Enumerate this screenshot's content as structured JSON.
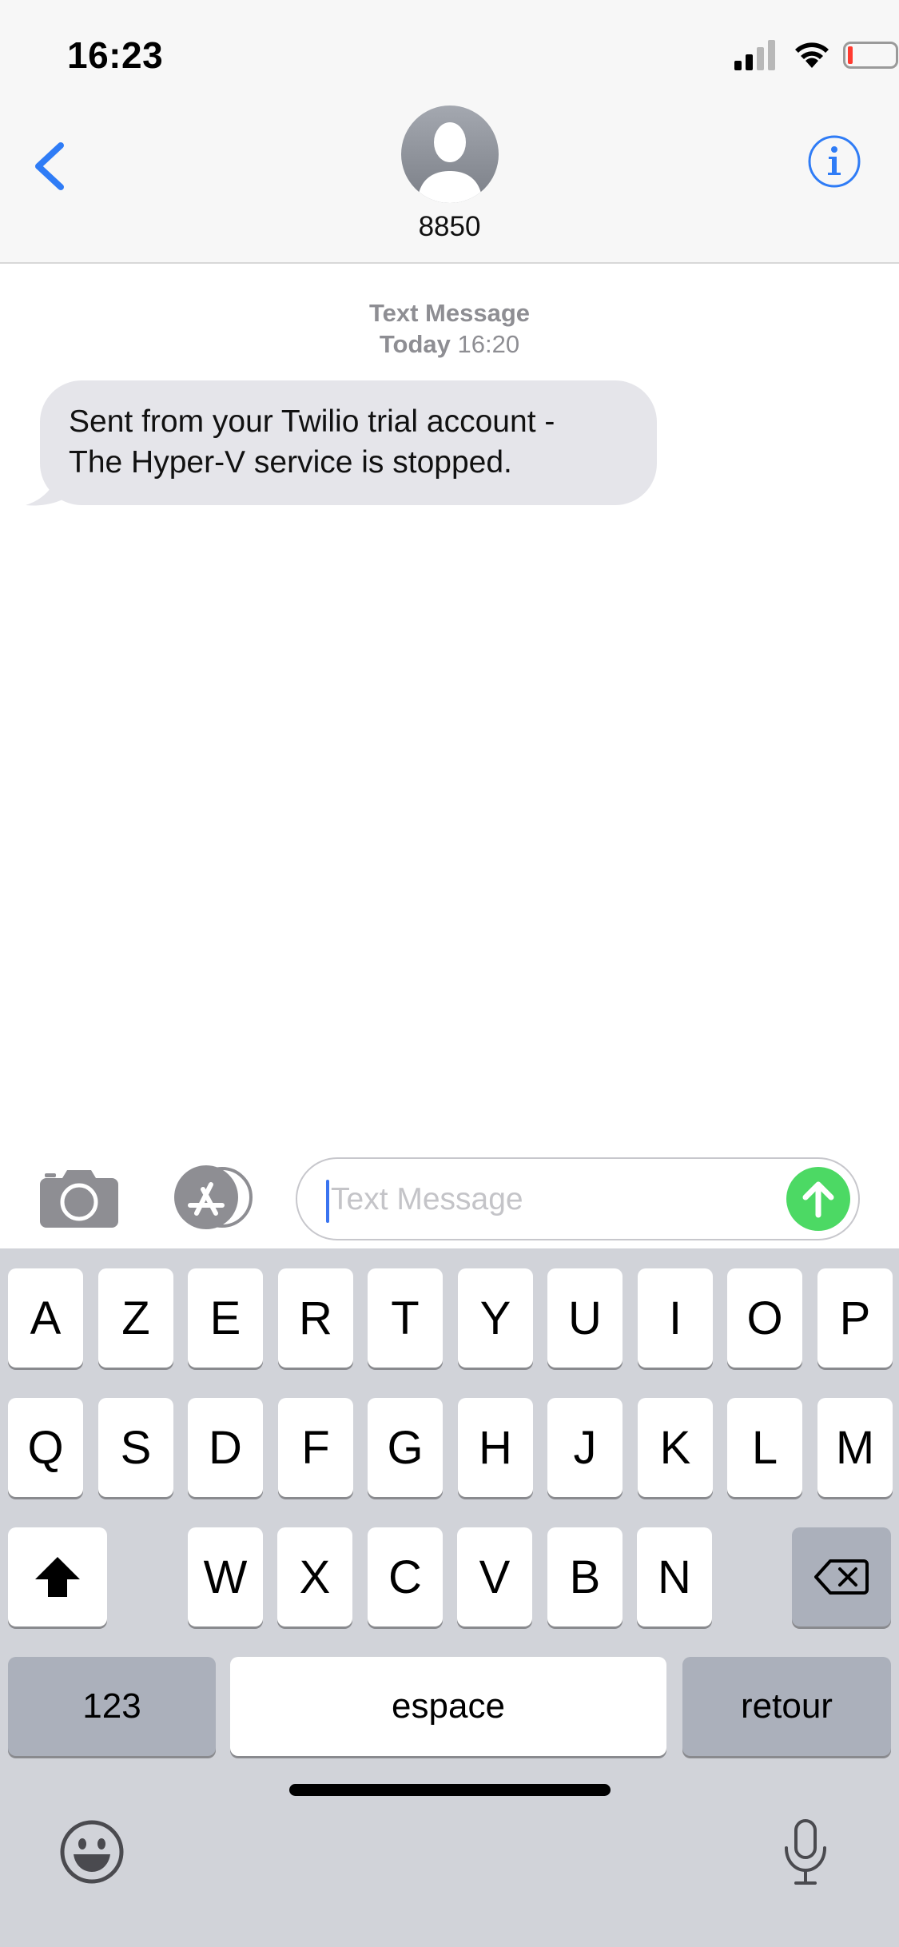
{
  "status_bar": {
    "time": "16:23",
    "signal_icon": "signal-bars-icon",
    "wifi_icon": "wifi-icon",
    "battery_icon": "battery-low-icon",
    "battery_color": "#ff3b30"
  },
  "header": {
    "contact_name": "8850",
    "back_icon": "chevron-left-icon",
    "info_icon": "info-icon",
    "accent": "#2f7cf6"
  },
  "conversation": {
    "meta_type": "Text Message",
    "meta_day": "Today",
    "meta_time": "16:20",
    "messages": [
      {
        "line1": "Sent from your Twilio trial account -",
        "line2": "The Hyper-V service is stopped."
      }
    ]
  },
  "input": {
    "placeholder": "Text Message",
    "send_color": "#4cd964"
  },
  "keyboard": {
    "row1": [
      "A",
      "Z",
      "E",
      "R",
      "T",
      "Y",
      "U",
      "I",
      "O",
      "P"
    ],
    "row2": [
      "Q",
      "S",
      "D",
      "F",
      "G",
      "H",
      "J",
      "K",
      "L",
      "M"
    ],
    "row3": [
      "W",
      "X",
      "C",
      "V",
      "B",
      "N"
    ],
    "numbers_label": "123",
    "space_label": "espace",
    "return_label": "retour"
  }
}
